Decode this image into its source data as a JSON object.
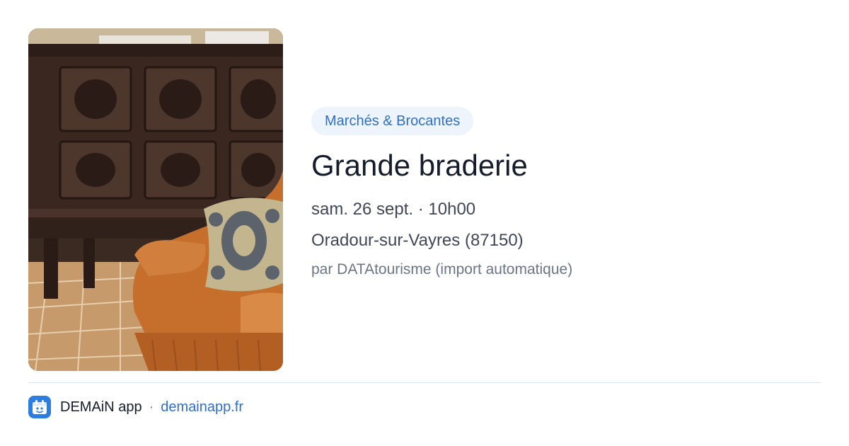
{
  "event": {
    "category": "Marchés & Brocantes",
    "title": "Grande braderie",
    "datetime": "sam. 26 sept. · 10h00",
    "location": "Oradour-sur-Vayres (87150)",
    "source": "par DATAtourisme (import automatique)",
    "photo_subject": "carved-wooden-cabinet-and-orange-armchair-photo"
  },
  "footer": {
    "app_name": "DEMAiN app",
    "separator": "·",
    "website": "demainapp.fr",
    "app_icon": "demain-app-icon"
  },
  "colors": {
    "accent": "#2f6fca",
    "tag_bg": "#eef4fc",
    "title": "#151c2b",
    "muted": "#6b7584",
    "divider": "#dbe3ea",
    "app_icon_bg": "#2b7de0"
  }
}
